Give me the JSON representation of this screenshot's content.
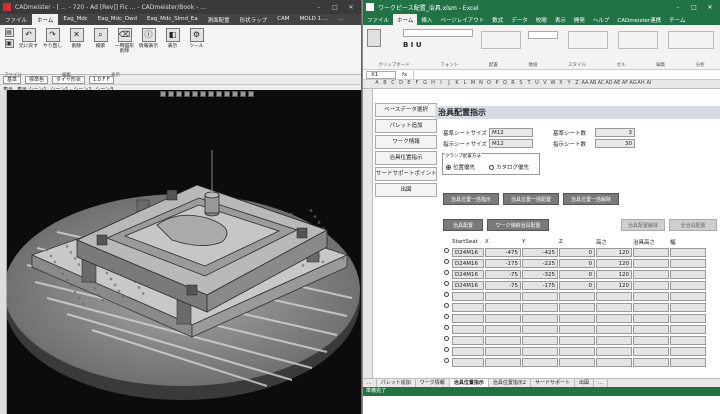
{
  "cad": {
    "title": "CADmeister - [ ... - 720 - Ad [Rev]] Fic ... - CADmeister/Book - ...",
    "tabs": [
      "ファイル",
      "ホーム",
      "Eag_Mdc",
      "Eag_Mdc_Dwd",
      "Eag_Mdc_Slmd_Ea",
      "測面配置",
      "形状ラップ",
      "CAM",
      "MOLD 1 ...",
      "..."
    ],
    "active_tab": "ホーム",
    "ribbon": [
      {
        "label": "元に戻す",
        "icon": "undo-icon",
        "glyph": "↶"
      },
      {
        "label": "やり直し",
        "icon": "redo-icon",
        "glyph": "↷"
      },
      {
        "label": "削除",
        "icon": "delete-icon",
        "glyph": "✕"
      },
      {
        "label": "検索",
        "icon": "search-icon",
        "glyph": "⌕"
      },
      {
        "label": "一時図形削除",
        "icon": "erase-icon",
        "glyph": "⌫"
      },
      {
        "label": "情報表示",
        "icon": "info-icon",
        "glyph": "ⓘ"
      },
      {
        "label": "表示",
        "icon": "view-icon",
        "glyph": "◧"
      },
      {
        "label": "ツール",
        "icon": "tool-icon",
        "glyph": "⚙"
      }
    ],
    "groups": [
      "ファイル",
      "編集",
      "表示"
    ],
    "prop_row": {
      "layer": "基準",
      "color": "標準色",
      "line": "ダイヤ形状",
      "scale": "1.0 F F"
    },
    "view_row": [
      "表示",
      "表示 シーン1",
      "シーン1 - シーン2",
      "シーン3"
    ]
  },
  "excel": {
    "title": "ワークピース配置_治具.xlsm - Excel",
    "tabs": [
      "ファイル",
      "ホーム",
      "挿入",
      "ページレイアウト",
      "数式",
      "データ",
      "校閲",
      "表示",
      "開発",
      "ヘルプ",
      "CADmeister連携",
      "チーム"
    ],
    "active_tab": "ホーム",
    "ribbon_groups": [
      "クリップボード",
      "フォント",
      "配置",
      "数値",
      "スタイル",
      "セル",
      "編集",
      "分析"
    ],
    "cell_ref": "X1",
    "columns": [
      "A",
      "B",
      "C",
      "D",
      "E",
      "F",
      "G",
      "H",
      "I",
      "J",
      "K",
      "L",
      "M",
      "N",
      "O",
      "P",
      "Q",
      "R",
      "S",
      "T",
      "U",
      "V",
      "W",
      "X",
      "Y",
      "Z",
      "AA",
      "AB",
      "AC",
      "AD",
      "AE",
      "AF",
      "AG",
      "AH",
      "AI"
    ],
    "side_menu": [
      "ベースデータ選択",
      "パレット追加",
      "ワーク情報",
      "治具位置指示",
      "サードサポートポイント",
      "出図"
    ],
    "panel_title": "治具配置指示",
    "fields": {
      "ref_size_label": "基準シートサイズ",
      "ref_size_value": "M12",
      "ref_count_label": "基準シート数",
      "ref_count_value": "3",
      "ind_size_label": "指示シートサイズ",
      "ind_size_value": "M12",
      "ind_count_label": "指示シート数",
      "ind_count_value": "30"
    },
    "clamp": {
      "title": "クランプ配置方法",
      "opt1": "位置優先",
      "opt2": "カタログ優先",
      "selected": "位置優先"
    },
    "buttons_row1": [
      "治具位置一括指示",
      "治具位置一括配置",
      "治具位置一括解除"
    ],
    "buttons_row2": [
      "治具配置",
      "ワーク傾斜治具配置",
      "治具配置解除",
      "全治具配置"
    ],
    "grid": {
      "headers": [
        "StartSeat",
        "X",
        "Y",
        "Z",
        "高さ",
        "治具高さ",
        "幅"
      ],
      "rows": [
        [
          "D24M16",
          "-475",
          "-425",
          "0",
          "120",
          "",
          ""
        ],
        [
          "D24M16",
          "-175",
          "-225",
          "0",
          "120",
          "",
          ""
        ],
        [
          "D24M16",
          "-75",
          "-325",
          "0",
          "120",
          "",
          ""
        ],
        [
          "D24M16",
          "-75",
          "-175",
          "0",
          "120",
          "",
          ""
        ]
      ],
      "empty_rows": 7
    },
    "sheet_tabs": [
      "...",
      "パレット追加",
      "ワーク情報",
      "治具位置指示",
      "治具位置指示2",
      "サードサポート",
      "出図",
      "..."
    ],
    "active_sheet": "治具位置指示",
    "status": "準備完了"
  }
}
